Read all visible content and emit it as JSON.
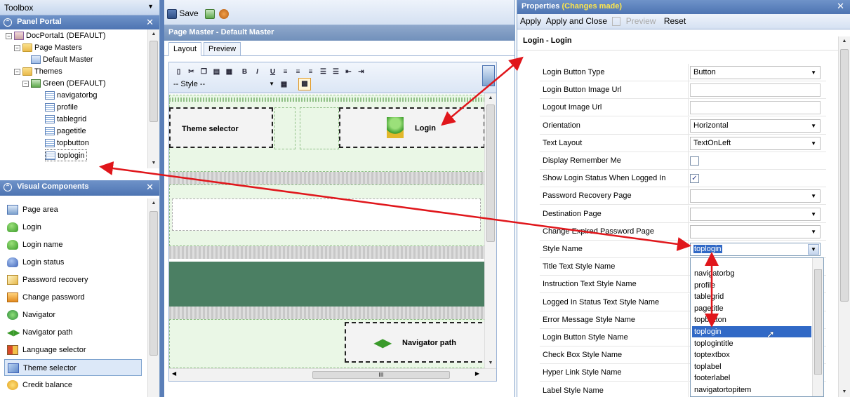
{
  "left": {
    "toolbox_title": "Toolbox",
    "panel_portal": {
      "title": "Panel Portal",
      "tree": [
        {
          "label": "DocPortal1 (DEFAULT)",
          "icon": "portal-icon"
        },
        {
          "label": "Page Masters",
          "icon": "folder-icon"
        },
        {
          "label": "Default Master",
          "icon": "page-master-icon"
        },
        {
          "label": "Themes",
          "icon": "folder-icon"
        },
        {
          "label": "Green (DEFAULT)",
          "icon": "theme-icon"
        },
        {
          "label": "navigatorbg",
          "icon": "style-icon"
        },
        {
          "label": "profile",
          "icon": "style-icon"
        },
        {
          "label": "tablegrid",
          "icon": "style-icon"
        },
        {
          "label": "pagetitle",
          "icon": "style-icon"
        },
        {
          "label": "topbutton",
          "icon": "style-icon"
        },
        {
          "label": "toplogin",
          "icon": "style-icon"
        }
      ]
    },
    "visual_components": {
      "title": "Visual Components",
      "items": [
        {
          "label": "Page area",
          "icon": "page-area-icon"
        },
        {
          "label": "Login",
          "icon": "login-icon"
        },
        {
          "label": "Login name",
          "icon": "login-name-icon"
        },
        {
          "label": "Login status",
          "icon": "login-status-icon"
        },
        {
          "label": "Password recovery",
          "icon": "password-recovery-icon"
        },
        {
          "label": "Change password",
          "icon": "change-password-icon"
        },
        {
          "label": "Navigator",
          "icon": "navigator-icon"
        },
        {
          "label": "Navigator path",
          "icon": "navigator-path-icon"
        },
        {
          "label": "Language selector",
          "icon": "language-selector-icon"
        },
        {
          "label": "Theme selector",
          "icon": "theme-selector-icon"
        },
        {
          "label": "Credit balance",
          "icon": "credit-balance-icon"
        }
      ]
    }
  },
  "middle": {
    "save_label": "Save",
    "title": "Page Master - Default Master",
    "tabs": [
      "Layout",
      "Preview"
    ],
    "style_select": "-- Style --",
    "theme_selector_label": "Theme selector",
    "login_label": "Login",
    "navigator_path_label": "Navigator path",
    "scroll_glyph": "III"
  },
  "right": {
    "title": "Properties",
    "changes": "(Changes made)",
    "toolbar": {
      "apply": "Apply",
      "apply_close": "Apply and Close",
      "preview": "Preview",
      "reset": "Reset"
    },
    "subtitle": "Login - Login",
    "props": [
      {
        "label": "Login Button Type",
        "type": "select",
        "value": "Button"
      },
      {
        "label": "Login Button Image Url",
        "type": "input",
        "value": ""
      },
      {
        "label": "Logout Image Url",
        "type": "input",
        "value": ""
      },
      {
        "label": "Orientation",
        "type": "select",
        "value": "Horizontal"
      },
      {
        "label": "Text Layout",
        "type": "select",
        "value": "TextOnLeft"
      },
      {
        "label": "Display Remember Me",
        "type": "check",
        "value": ""
      },
      {
        "label": "Show Login Status When Logged In",
        "type": "check",
        "value": "✓"
      },
      {
        "label": "Password Recovery Page",
        "type": "select",
        "value": ""
      },
      {
        "label": "Destination Page",
        "type": "select",
        "value": ""
      },
      {
        "label": "Change Expired Password Page",
        "type": "select",
        "value": ""
      },
      {
        "label": "Style Name",
        "type": "active",
        "value": "toplogin"
      },
      {
        "label": "Title Text Style Name",
        "type": "none",
        "value": ""
      },
      {
        "label": "Instruction Text Style Name",
        "type": "none",
        "value": ""
      },
      {
        "label": "Logged In Status Text Style Name",
        "type": "none",
        "value": ""
      },
      {
        "label": "Error Message Style Name",
        "type": "none",
        "value": ""
      },
      {
        "label": "Login Button Style Name",
        "type": "none",
        "value": ""
      },
      {
        "label": "Check Box Style Name",
        "type": "none",
        "value": ""
      },
      {
        "label": "Hyper Link Style Name",
        "type": "none",
        "value": ""
      },
      {
        "label": "Label Style Name",
        "type": "none",
        "value": ""
      }
    ],
    "dropdown_options": [
      "navigatorbg",
      "profile",
      "tablegrid",
      "pagetitle",
      "topbutton",
      "toplogin",
      "toplogintitle",
      "toptextbox",
      "toplabel",
      "footerlabel",
      "navigatortopitem"
    ],
    "dropdown_selected": "toplogin"
  },
  "colors": {
    "header_blue": "#4d74b2",
    "selection_blue": "#3169c6",
    "arrow_red": "#e0161b",
    "green_band": "#4b7f63",
    "changes_yellow": "#ffe74a"
  }
}
